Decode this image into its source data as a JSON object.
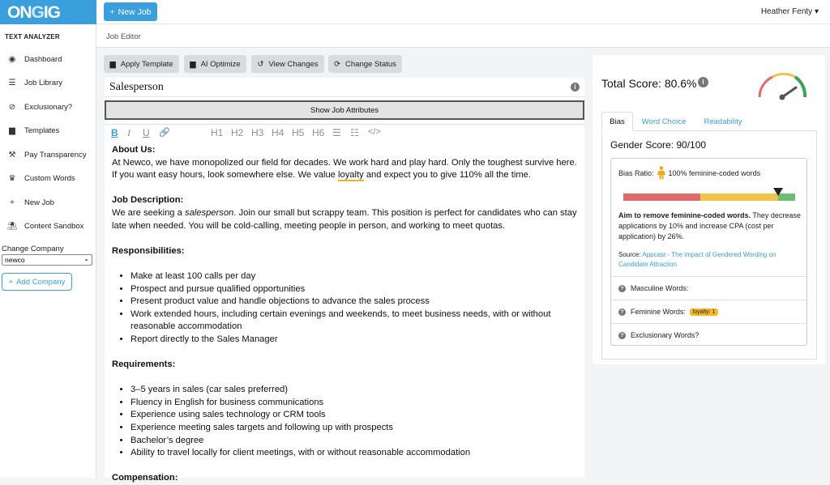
{
  "app": {
    "logo_on": "ON",
    "logo_g": "G",
    "logo_ig": "IG"
  },
  "topbar": {
    "new_job_label": "New Job",
    "user_name": "Heather Fenty",
    "user_caret": "▾"
  },
  "breadcrumb": "Job Editor",
  "sidebar": {
    "heading": "TEXT ANALYZER",
    "items": [
      {
        "label": "Dashboard",
        "icon": "dashboard-icon"
      },
      {
        "label": "Job Library",
        "icon": "list-icon"
      },
      {
        "label": "Exclusionary?",
        "icon": "ban-icon"
      },
      {
        "label": "Templates",
        "icon": "file-icon"
      },
      {
        "label": "Pay Transparency",
        "icon": "gavel-icon"
      },
      {
        "label": "Custom Words",
        "icon": "trophy-icon"
      },
      {
        "label": "New Job",
        "icon": "plus-icon"
      },
      {
        "label": "Content Sandbox",
        "icon": "sandbox-icon"
      }
    ],
    "change_company_label": "Change Company",
    "company_value": "newco",
    "add_company_label": "Add Company"
  },
  "toolbar": {
    "apply_template": "Apply Template",
    "ai_optimize": "AI Optimize",
    "view_changes": "View Changes",
    "change_status": "Change Status"
  },
  "editor": {
    "job_title": "Salesperson",
    "show_attributes": "Show Job Attributes",
    "format_buttons": {
      "bold": "B",
      "italic": "I",
      "underline": "U",
      "link": "🔗",
      "h1": "H1",
      "h2": "H2",
      "h3": "H3",
      "h4": "H4",
      "h5": "H5",
      "h6": "H6",
      "ul": "☰",
      "ol": "☷",
      "code": "</>"
    },
    "about_heading": "About Us:",
    "about_before": "At Newco, we have monopolized our field for decades. We work hard and play hard. Only the toughest survive here. If you want easy hours, look somewhere else. We value ",
    "about_flagged": "loyalty",
    "about_after": " and expect you to give 110% all the time.",
    "desc_heading": "Job Description:",
    "desc_before": "We are seeking a ",
    "desc_italic": "salesperson",
    "desc_after": ". Join our small but scrappy team. This position is perfect for candidates who can stay late when needed. You will be cold-calling, meeting people in person, and working to meet quotas.",
    "resp_heading": "Responsibilities:",
    "responsibilities": [
      "Make at least 100 calls per day",
      "Prospect and pursue qualified opportunities",
      "Present product value and handle objections to advance the sales process",
      "Work extended hours, including certain evenings and weekends, to meet business needs, with or without reasonable accommodation",
      "Report directly to the Sales Manager"
    ],
    "req_heading": "Requirements:",
    "requirements": [
      "3–5 years in sales (car sales preferred)",
      "Fluency in English for business communications",
      "Experience using sales technology or CRM tools",
      "Experience meeting sales targets and following up with prospects",
      "Bachelor’s degree",
      "Ability to travel locally for client meetings, with or without reasonable accommodation"
    ],
    "comp_heading": "Compensation:"
  },
  "score": {
    "total_label": "Total Score: 80.6%",
    "gauge_value_percent": 80.6,
    "tabs": [
      "Bias",
      "Word Choice",
      "Readability"
    ],
    "gender_score": "Gender Score: 90/100",
    "bias_ratio_label": "Bias Ratio:",
    "bias_ratio_value": "100% feminine-coded words",
    "bias_marker_percent": 90,
    "aim_bold": "Aim to remove feminine-coded words.",
    "aim_text": " They decrease applications by 10% and increase CPA (cost per application) by 26%.",
    "source_label": "Source:",
    "source_link": "Appcast - The impact of Gendered Wording on Candidate Attraction",
    "masculine_label": "Masculine Words:",
    "feminine_label": "Feminine Words:",
    "feminine_badge": "loyalty: 1",
    "exclusionary_label": "Exclusionary Words?"
  },
  "colors": {
    "brand": "#3a9fdc",
    "bar_red": "#e06a6a",
    "bar_yellow": "#f2c24a",
    "bar_green": "#6bbf72",
    "badge": "#f5b82a"
  }
}
